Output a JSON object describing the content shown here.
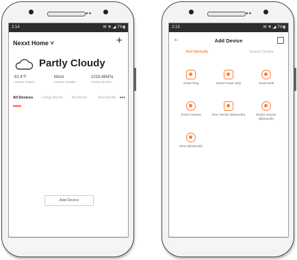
{
  "phone1": {
    "status_time": "2:14",
    "status_right": "✉ ▼.◢ 7%▮",
    "home_title": "Nexxt Home ˅",
    "weather": "Partly Cloudy",
    "stats": [
      {
        "value": "81.4°F",
        "label": "Outdoor Temper..."
      },
      {
        "value": "Moist",
        "label": "Outdoor Humidity"
      },
      {
        "value": "1018.46hPa",
        "label": "Outdoor Air Pres..."
      }
    ],
    "tabs": [
      "All Devices",
      "Living Room",
      "Bedroom",
      "Second Be"
    ],
    "add_device": "Add Device"
  },
  "phone2": {
    "status_time": "2:13",
    "status_right": "✉ ▼.◢ 7%▮",
    "title": "Add Device",
    "tab_manual": "Add Manually",
    "tab_search": "Search Device",
    "devices": [
      {
        "label": "Smart Plug",
        "icon": "plug-icon"
      },
      {
        "label": "Smart Power Strip",
        "icon": "power-strip-icon"
      },
      {
        "label": "Smart Bulb",
        "icon": "bulb-icon"
      },
      {
        "label": "Smart Camera",
        "icon": "camera-icon"
      },
      {
        "label": "Door Sensor (Bluetooth)",
        "icon": "door-sensor-icon"
      },
      {
        "label": "Motion Sensor (Bluetooth)",
        "icon": "motion-sensor-icon"
      },
      {
        "label": "Siren (Bluetooth)",
        "icon": "siren-icon"
      }
    ]
  },
  "colors": {
    "accent": "#ff5b24",
    "icon": "#ff7a33"
  }
}
